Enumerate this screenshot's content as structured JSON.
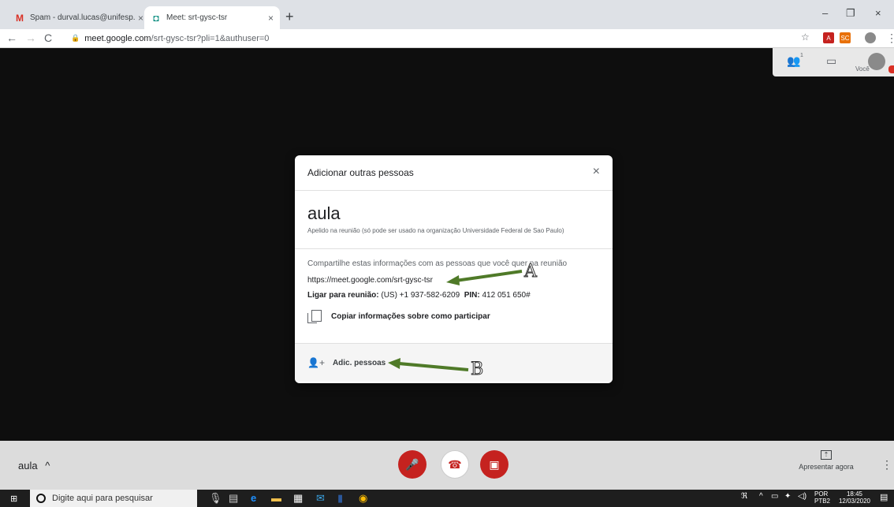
{
  "browser": {
    "tabs": [
      {
        "title": "Spam - durval.lucas@unifesp.br -",
        "favicon": "gmail-icon",
        "favicon_char": "M",
        "favicon_color": "#d93025"
      },
      {
        "title": "Meet: srt-gysc-tsr",
        "favicon": "meet-icon",
        "favicon_char": "◘",
        "favicon_color": "#00897b"
      }
    ],
    "tab_close": "×",
    "new_tab": "+",
    "window": {
      "minimize": "–",
      "restore": "❐",
      "close": "×"
    },
    "nav": {
      "back": "←",
      "forward": "→",
      "reload": "C"
    },
    "url_host": "meet.google.com",
    "url_path": "/srt-gysc-tsr?pli=1&authuser=0",
    "star": "☆",
    "extensions": [
      {
        "label": "A",
        "color": "#c5221f"
      },
      {
        "label": "SC",
        "color": "#e8710a"
      }
    ],
    "menu": "⋮"
  },
  "meet_topright": {
    "people_icon": "👥",
    "people_count": "1",
    "chat_icon": "▭",
    "you_label": "Você"
  },
  "dialog": {
    "title": "Adicionar outras pessoas",
    "close": "×",
    "meeting_name": "aula",
    "nickname_note": "Apelido na reunião (só pode ser usado na organização Universidade Federal de Sao Paulo)",
    "share_text": "Compartilhe estas informações com as pessoas que você quer na reunião",
    "link": "https://meet.google.com/srt-gysc-tsr",
    "dialin_label": "Ligar para reunião:",
    "dialin_number": "(US) +1 937-582-6209",
    "pin_label": "PIN:",
    "pin": "412 051 650#",
    "copy_label": "Copiar informações sobre como participar",
    "add_people_icon": "👤+",
    "add_people_label": "Adic. pessoas"
  },
  "annotations": {
    "a": "A",
    "b": "B",
    "arrow_color": "#4f7a28"
  },
  "meetbar": {
    "meeting_name": "aula",
    "chevron": "^",
    "mic_icon": "🎤",
    "hangup_icon": "☎",
    "cam_icon": "▣",
    "present_icon": "⇡",
    "present_label": "Apresentar agora",
    "more": "⋮"
  },
  "taskbar": {
    "start_icon": "⊞",
    "search_placeholder": "Digite aqui para pesquisar",
    "lang_top": "POR",
    "lang_bottom": "PTB2",
    "time": "18:45",
    "date": "12/03/2020"
  }
}
